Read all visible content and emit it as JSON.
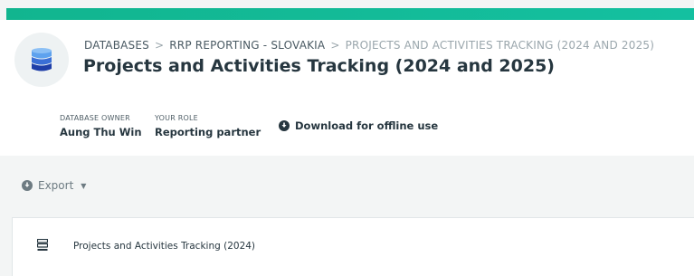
{
  "breadcrumb": {
    "items": [
      "DATABASES",
      "RRP REPORTING - SLOVAKIA"
    ],
    "separator": ">",
    "current": "PROJECTS AND ACTIVITIES TRACKING (2024 AND 2025)"
  },
  "page_title": "Projects and Activities Tracking (2024 and 2025)",
  "meta": {
    "owner_label": "DATABASE OWNER",
    "owner_value": "Aung Thu Win",
    "role_label": "YOUR ROLE",
    "role_value": "Reporting partner"
  },
  "download": {
    "label": "Download for offline use",
    "icon": "download-circle-icon"
  },
  "toolbar": {
    "export_label": "Export",
    "export_icon": "export-circle-icon",
    "caret_icon": "caret-down-icon"
  },
  "forms": [
    {
      "label": "Projects and Activities Tracking (2024)",
      "icon": "form-list-icon"
    }
  ],
  "colors": {
    "top_bar": "#12b58f",
    "database_icon_top": "#5ea2ee",
    "database_icon_bottom": "#1f3fa8",
    "text_dark": "#26363f",
    "text_muted": "#9aa6ac"
  }
}
